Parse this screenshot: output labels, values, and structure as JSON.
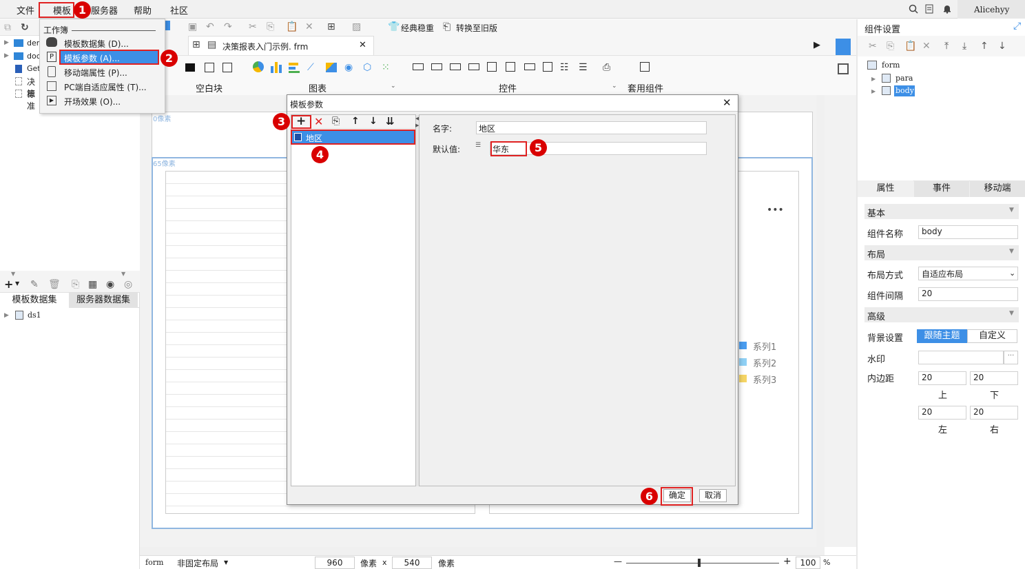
{
  "menubar": {
    "items": [
      "文件",
      "模板",
      "服务器",
      "帮助",
      "社区"
    ],
    "user": "Alicehyy"
  },
  "template_menu": {
    "header": "工作簿",
    "items": [
      "模板数据集 (D)...",
      "模板参数 (A)...",
      "移动端属性 (P)...",
      "PC端自适应属性 (T)...",
      "开场效果 (O)..."
    ]
  },
  "left_tree": {
    "items": [
      "dem",
      "doc",
      "Get",
      "决策",
      "标准"
    ]
  },
  "left_dataset": {
    "tabs": [
      "模板数据集",
      "服务器数据集"
    ],
    "items": [
      "ds1"
    ]
  },
  "toolbar": {
    "classic_label": "经典稳重",
    "convert_label": "转换至旧版",
    "file_tab": "决策报表入门示例. frm",
    "groups": [
      "空白块",
      "图表",
      "控件",
      "套用组件"
    ]
  },
  "canvas": {
    "label_0": "0像素",
    "label_65": "65像素",
    "legend": [
      "系列1",
      "系列2",
      "系列3"
    ],
    "legend_colors": [
      "#4a9df0",
      "#8fd0f5",
      "#f5d565"
    ],
    "more": "•••"
  },
  "dialog": {
    "title": "模板参数",
    "param_name": "地区",
    "name_label": "名字:",
    "name_value": "地区",
    "default_label": "默认值:",
    "default_value": "华东",
    "ok": "确定",
    "cancel": "取消"
  },
  "right_panel": {
    "title": "组件设置",
    "tree": [
      "form",
      "para",
      "body"
    ],
    "tabs": [
      "属性",
      "事件",
      "移动端"
    ],
    "section_basic": "基本",
    "name_label": "组件名称",
    "name_value": "body",
    "section_layout": "布局",
    "layout_label": "布局方式",
    "layout_value": "自适应布局",
    "gap_label": "组件间隔",
    "gap_value": "20",
    "section_adv": "高级",
    "bg_label": "背景设置",
    "bg_opt1": "跟随主题",
    "bg_opt2": "自定义",
    "watermark_label": "水印",
    "padding_label": "内边距",
    "pad_top": "20",
    "pad_bottom": "20",
    "pad_left": "20",
    "pad_right": "20",
    "top_label": "上",
    "bottom_label": "下",
    "left_label": "左",
    "right_label": "右"
  },
  "statusbar": {
    "form": "form",
    "layout": "非固定布局",
    "width": "960",
    "unit1": "像素",
    "x": "x",
    "height": "540",
    "unit2": "像素",
    "zoom": "100",
    "percent": "%",
    "minus": "—",
    "plus": "+"
  },
  "badges": [
    "1",
    "2",
    "3",
    "4",
    "5",
    "6"
  ],
  "colors": {
    "accent": "#3d8fe6",
    "selected": "#3d8fe6",
    "annotation": "#d90000"
  }
}
